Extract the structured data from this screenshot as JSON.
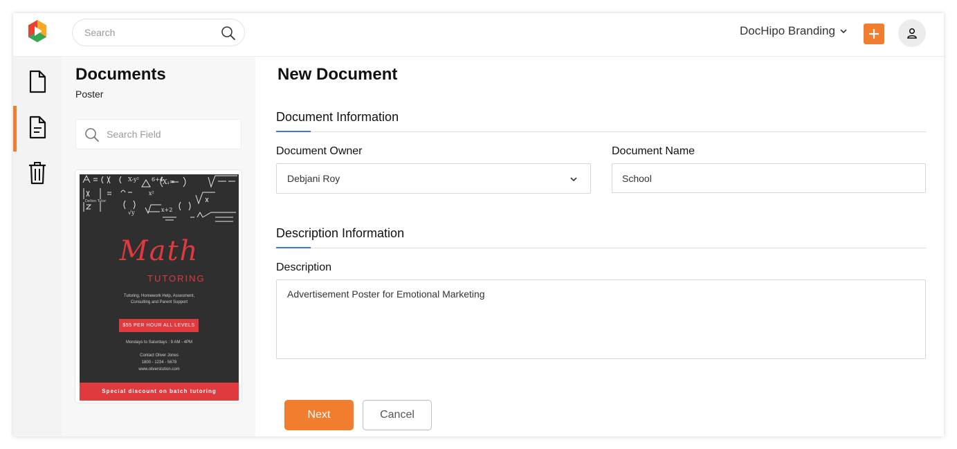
{
  "colors": {
    "accent": "#f07e2e",
    "section_underline": "#3a7bd5",
    "poster_red": "#e0393e",
    "poster_bg": "#2f2f2f"
  },
  "header": {
    "search_placeholder": "Search",
    "workspace": "DocHipo Branding",
    "icons": [
      "dochipo-logo-icon",
      "search-icon",
      "chevron-down-icon",
      "plus-icon",
      "user-icon"
    ]
  },
  "rail": {
    "items": [
      {
        "name": "document-icon",
        "active": false
      },
      {
        "name": "document-lines-icon",
        "active": true
      },
      {
        "name": "trash-icon",
        "active": false
      }
    ]
  },
  "sidebar": {
    "title": "Documents",
    "subtitle": "Poster",
    "search_placeholder": "Search Field",
    "template": {
      "title": "Math",
      "subtitle": "TUTORING",
      "desc_line1": "Tutoring, Homework Help, Assesment,",
      "desc_line2": "Consulting and Parent Support",
      "price": "$55 PER HOUR ALL LEVELS",
      "hours": "Mondays to Saturdays : 9 AM - 4PM",
      "contact_name": "Contact Oliver Jones",
      "contact_phone": "1800 - 1234 - 5678",
      "contact_web": "www.oliverstution.com",
      "footer": "Special discount on batch tutoring"
    }
  },
  "main": {
    "title": "New Document",
    "section1": "Document Information",
    "owner_label": "Document Owner",
    "owner_value": "Debjani Roy",
    "name_label": "Document Name",
    "name_value": "School",
    "section2": "Description Information",
    "description_label": "Description",
    "description_value": "Advertisement Poster for Emotional Marketing",
    "next_label": "Next",
    "cancel_label": "Cancel"
  }
}
